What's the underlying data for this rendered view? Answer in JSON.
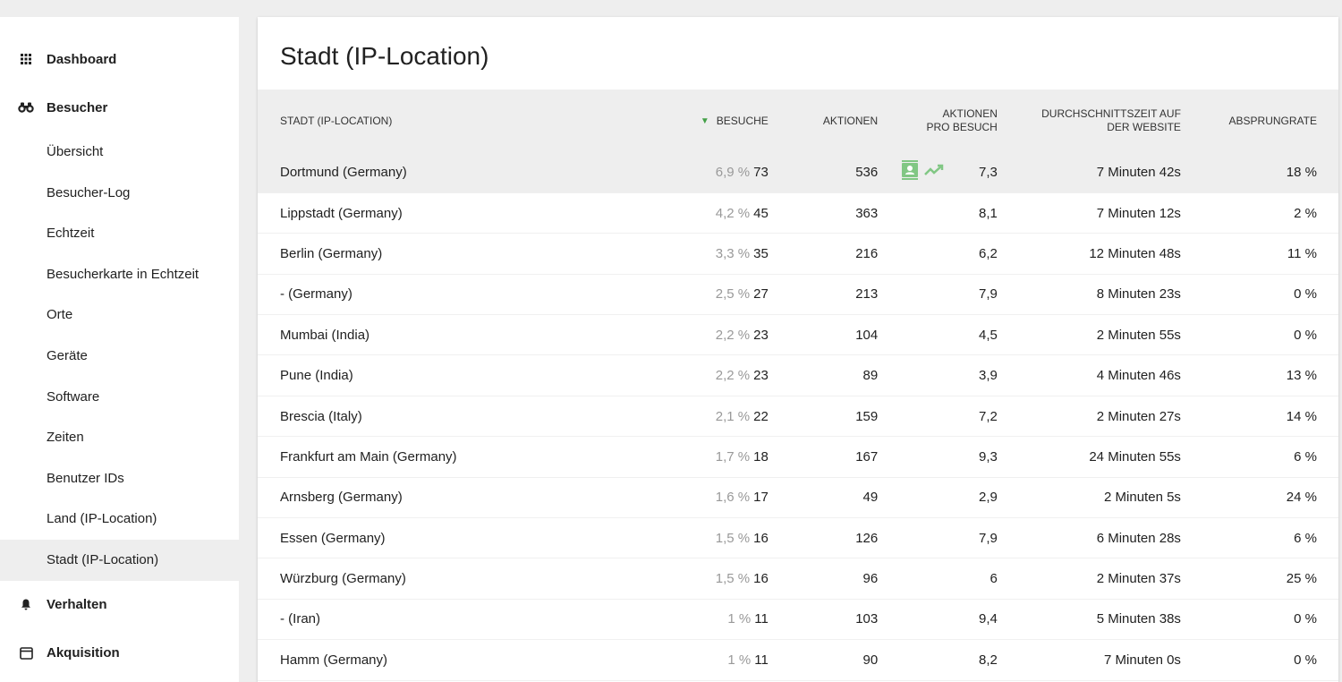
{
  "sidebar": {
    "dashboard": "Dashboard",
    "visitors": "Besucher",
    "submenu": [
      "Übersicht",
      "Besucher-Log",
      "Echtzeit",
      "Besucherkarte in Echtzeit",
      "Orte",
      "Geräte",
      "Software",
      "Zeiten",
      "Benutzer IDs",
      "Land (IP-Location)",
      "Stadt (IP-Location)"
    ],
    "behaviour": "Verhalten",
    "acquisition": "Akquisition"
  },
  "report": {
    "title": "Stadt (IP-Location)",
    "columns": {
      "label": "Stadt (IP-Location)",
      "visits": "Besuche",
      "actions": "Aktionen",
      "actions_per_visit_1": "Aktionen",
      "actions_per_visit_2": "pro Besuch",
      "avg_time_1": "Durchschnittszeit auf",
      "avg_time_2": "der Website",
      "bounce": "Absprungrate"
    },
    "rows": [
      {
        "city": "Dortmund (Germany)",
        "pct": "6,9 %",
        "visits": "73",
        "actions": "536",
        "apv": "7,3",
        "time": "7 Minuten 42s",
        "bounce": "18 %"
      },
      {
        "city": "Lippstadt (Germany)",
        "pct": "4,2 %",
        "visits": "45",
        "actions": "363",
        "apv": "8,1",
        "time": "7 Minuten 12s",
        "bounce": "2 %"
      },
      {
        "city": "Berlin (Germany)",
        "pct": "3,3 %",
        "visits": "35",
        "actions": "216",
        "apv": "6,2",
        "time": "12 Minuten 48s",
        "bounce": "11 %"
      },
      {
        "city": "- (Germany)",
        "pct": "2,5 %",
        "visits": "27",
        "actions": "213",
        "apv": "7,9",
        "time": "8 Minuten 23s",
        "bounce": "0 %"
      },
      {
        "city": "Mumbai (India)",
        "pct": "2,2 %",
        "visits": "23",
        "actions": "104",
        "apv": "4,5",
        "time": "2 Minuten 55s",
        "bounce": "0 %"
      },
      {
        "city": "Pune (India)",
        "pct": "2,2 %",
        "visits": "23",
        "actions": "89",
        "apv": "3,9",
        "time": "4 Minuten 46s",
        "bounce": "13 %"
      },
      {
        "city": "Brescia (Italy)",
        "pct": "2,1 %",
        "visits": "22",
        "actions": "159",
        "apv": "7,2",
        "time": "2 Minuten 27s",
        "bounce": "14 %"
      },
      {
        "city": "Frankfurt am Main (Germany)",
        "pct": "1,7 %",
        "visits": "18",
        "actions": "167",
        "apv": "9,3",
        "time": "24 Minuten 55s",
        "bounce": "6 %"
      },
      {
        "city": "Arnsberg (Germany)",
        "pct": "1,6 %",
        "visits": "17",
        "actions": "49",
        "apv": "2,9",
        "time": "2 Minuten 5s",
        "bounce": "24 %"
      },
      {
        "city": "Essen (Germany)",
        "pct": "1,5 %",
        "visits": "16",
        "actions": "126",
        "apv": "7,9",
        "time": "6 Minuten 28s",
        "bounce": "6 %"
      },
      {
        "city": "Würzburg (Germany)",
        "pct": "1,5 %",
        "visits": "16",
        "actions": "96",
        "apv": "6",
        "time": "2 Minuten 37s",
        "bounce": "25 %"
      },
      {
        "city": "- (Iran)",
        "pct": "1 %",
        "visits": "11",
        "actions": "103",
        "apv": "9,4",
        "time": "5 Minuten 38s",
        "bounce": "0 %"
      },
      {
        "city": "Hamm (Germany)",
        "pct": "1 %",
        "visits": "11",
        "actions": "90",
        "apv": "8,2",
        "time": "7 Minuten 0s",
        "bounce": "0 %"
      }
    ]
  },
  "colors": {
    "accent_green": "#43a047",
    "icon_green": "#81c784",
    "header_bg": "#eeeeee",
    "muted_text": "#999999"
  },
  "icons": {
    "row_action_1": "visitor-profile-icon",
    "row_action_2": "row-evolution-icon"
  }
}
